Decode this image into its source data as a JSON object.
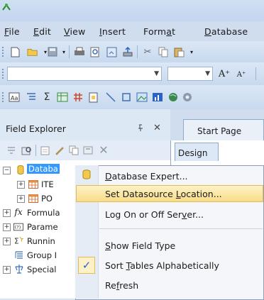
{
  "menubar": {
    "items": [
      {
        "label": "File",
        "mnemonic": "F",
        "rest": "ile"
      },
      {
        "label": "Edit",
        "mnemonic": "E",
        "rest": "dit"
      },
      {
        "label": "View",
        "mnemonic": "V",
        "rest": "iew"
      },
      {
        "label": "Insert",
        "mnemonic": "I",
        "rest": "nsert"
      },
      {
        "label": "Format",
        "pre": "Form",
        "mnemonic": "a",
        "rest": "t"
      },
      {
        "label": "Database",
        "mnemonic": "D",
        "rest": "atabase"
      }
    ]
  },
  "toolbar": {
    "font_size_buttons": [
      "A⁺",
      "A⁺"
    ]
  },
  "field_explorer": {
    "title": "Field Explorer",
    "pin": "ᵖ",
    "close": "✕",
    "tree": [
      {
        "label": "Database Fields",
        "visible": "Databa",
        "icon": "database-icon",
        "expanded": true,
        "selected": true
      },
      {
        "label": "ITEMS",
        "visible": "ITE",
        "icon": "table-icon",
        "indent": 1
      },
      {
        "label": "PO",
        "visible": "PO",
        "icon": "table-icon",
        "indent": 1
      },
      {
        "label": "Formula Fields",
        "visible": "Formula",
        "icon": "formula-icon"
      },
      {
        "label": "Parameter Fields",
        "visible": "Parame",
        "icon": "parameter-icon"
      },
      {
        "label": "Running Total Fields",
        "visible": "Runnin",
        "icon": "running-total-icon"
      },
      {
        "label": "Group Name Fields",
        "visible": "Group I",
        "icon": "group-icon"
      },
      {
        "label": "Special Fields",
        "visible": "Special",
        "icon": "special-fields-icon"
      }
    ]
  },
  "tabs": {
    "start_page": "Start Page",
    "design": "Design"
  },
  "context_menu": {
    "items": [
      {
        "label": "Database Expert...",
        "mnemonic": "D",
        "rest": "atabase Expert..."
      },
      {
        "label": "Set Datasource Location...",
        "pre": "Set Datasource ",
        "mnemonic": "L",
        "rest": "ocation...",
        "highlighted": true
      },
      {
        "label": "Log On or Off Server...",
        "pre": "Log On or Off Ser",
        "mnemonic": "v",
        "rest": "er..."
      },
      {
        "label": "Show Field Type",
        "mnemonic": "S",
        "rest": "how Field Type"
      },
      {
        "label": "Sort Tables Alphabetically",
        "pre": "Sort ",
        "mnemonic": "T",
        "rest": "ables Alphabetically",
        "checked": true
      },
      {
        "label": "Refresh",
        "pre": "Re",
        "mnemonic": "f",
        "rest": "resh"
      }
    ],
    "check_mark": "✓"
  },
  "colors": {
    "selection": "#3399ff",
    "highlight": "#f8dc88",
    "check": "#2a63c8"
  }
}
